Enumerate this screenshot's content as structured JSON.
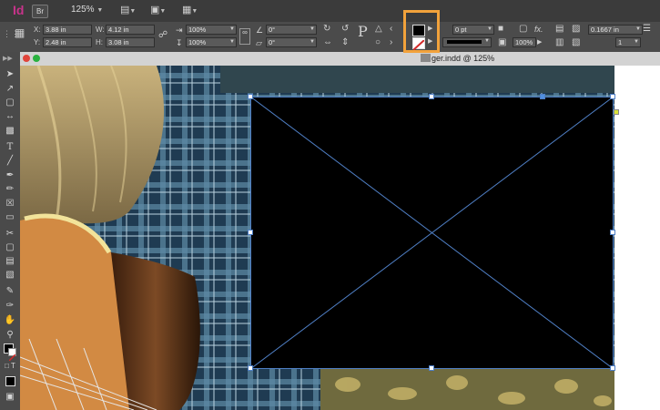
{
  "app": {
    "logo": "Id",
    "bridge_button": "Br",
    "zoom": "125%"
  },
  "control_panel": {
    "x_label": "X:",
    "x_value": "3.88 in",
    "y_label": "Y:",
    "y_value": "2.48 in",
    "w_label": "W:",
    "w_value": "4.12 in",
    "h_label": "H:",
    "h_value": "3.08 in",
    "scale_x": "100%",
    "scale_y": "100%",
    "rotate": "0°",
    "shear": "0°",
    "stroke_weight": "0 pt",
    "opacity": "100%",
    "offset": "0.1667 in",
    "columns": "1",
    "fill_color": "#000000",
    "accent_highlight": "#f2a23b"
  },
  "document": {
    "title": "ger.indd @ 125%"
  }
}
